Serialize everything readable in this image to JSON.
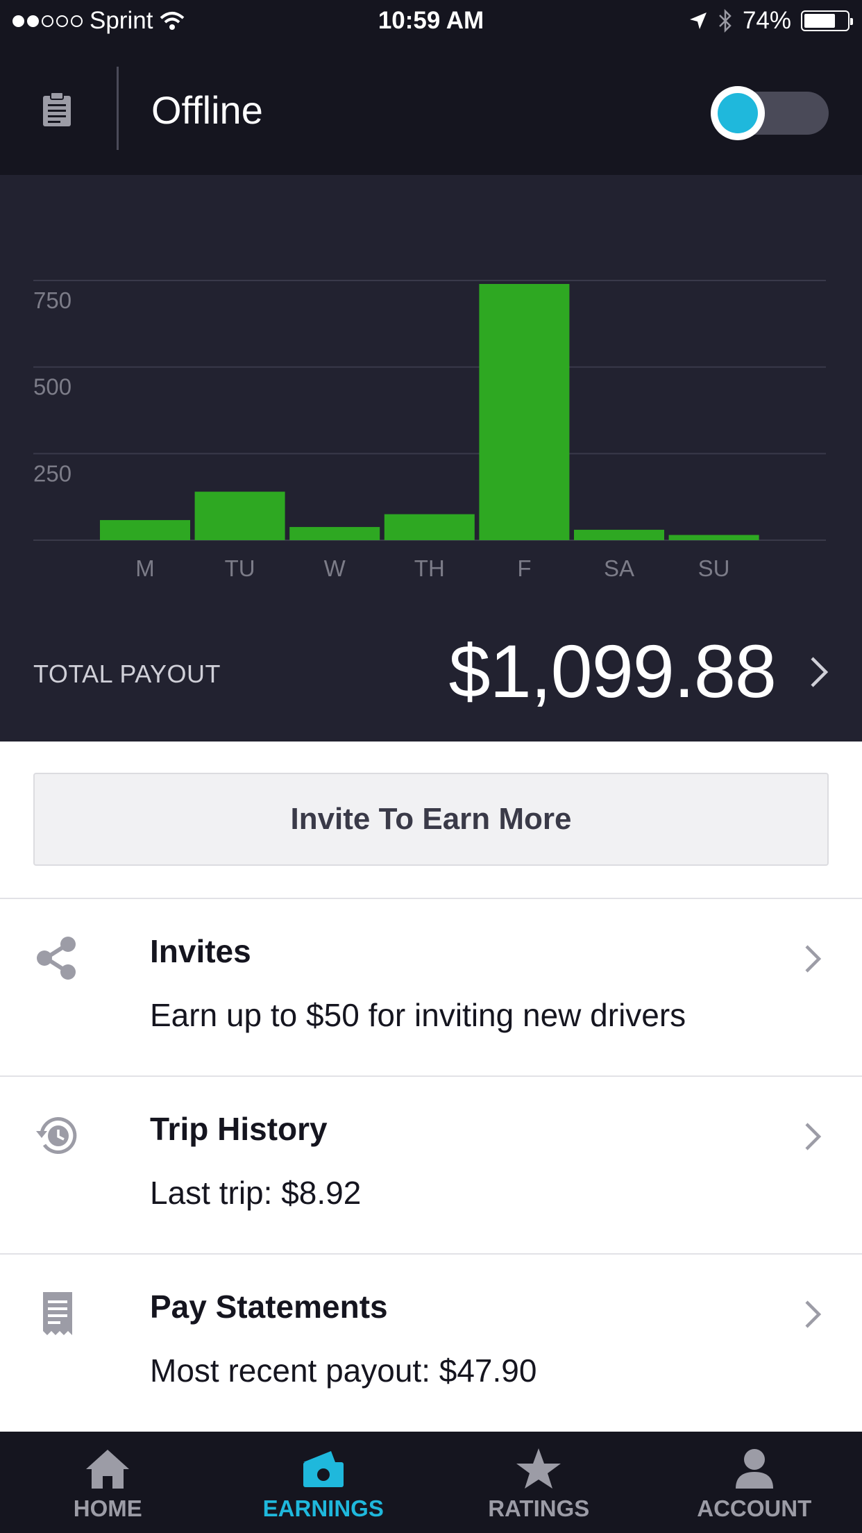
{
  "status_bar": {
    "signal_filled": 2,
    "signal_total": 5,
    "carrier": "Sprint",
    "time": "10:59 AM",
    "battery": "74%",
    "battery_level": 0.74
  },
  "header": {
    "title": "Offline",
    "toggle_on": false
  },
  "chart_data": {
    "type": "bar",
    "categories": [
      "M",
      "TU",
      "W",
      "TH",
      "F",
      "SA",
      "SU"
    ],
    "values": [
      58,
      140,
      38,
      75,
      740,
      30,
      15
    ],
    "yticks": [
      250,
      500,
      750
    ],
    "ylim": [
      0,
      750
    ],
    "grid": true,
    "bar_color": "#2ea822"
  },
  "payout": {
    "label": "TOTAL PAYOUT",
    "value": "$1,099.88"
  },
  "invite_button": {
    "label": "Invite To Earn More"
  },
  "rows": [
    {
      "icon": "share-icon",
      "title": "Invites",
      "subtitle": "Earn up to $50 for inviting new drivers"
    },
    {
      "icon": "history-icon",
      "title": "Trip History",
      "subtitle": "Last trip: $8.92"
    },
    {
      "icon": "receipt-icon",
      "title": "Pay Statements",
      "subtitle": "Most recent payout: $47.90"
    }
  ],
  "tabs": [
    {
      "icon": "home-icon",
      "label": "HOME",
      "active": false
    },
    {
      "icon": "earnings-icon",
      "label": "EARNINGS",
      "active": true
    },
    {
      "icon": "star-icon",
      "label": "RATINGS",
      "active": false
    },
    {
      "icon": "person-icon",
      "label": "ACCOUNT",
      "active": false
    }
  ],
  "colors": {
    "accent": "#1fb8dc",
    "header_bg": "#15151f",
    "chart_bg": "#222230",
    "bar": "#2ea822"
  }
}
